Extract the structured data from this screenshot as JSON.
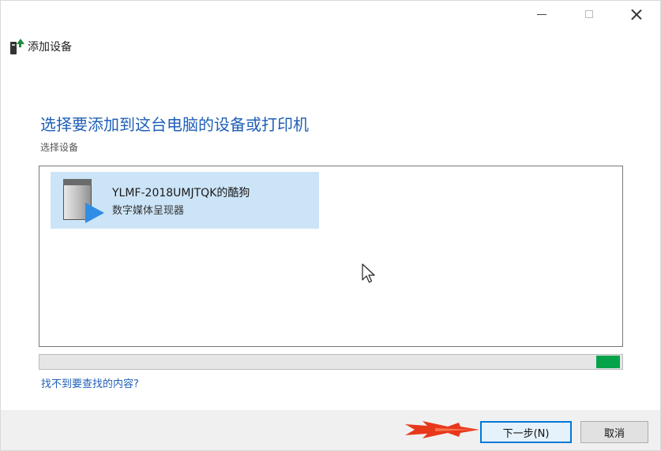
{
  "window": {
    "controls": {
      "minimize": "minimize",
      "maximize": "maximize",
      "close": "close"
    }
  },
  "header": {
    "title": "添加设备",
    "icon": "add-device-icon"
  },
  "main": {
    "heading": "选择要添加到这台电脑的设备或打印机",
    "sub_label": "选择设备",
    "devices": [
      {
        "name": "YLMF-2018UMJTQK的酷狗",
        "type": "数字媒体呈现器",
        "icon": "media-renderer-icon",
        "selected": true
      }
    ]
  },
  "progress": {
    "fill_start": 0.955,
    "fill_end": 0.995,
    "color": "#06a34b"
  },
  "help_link": "找不到要查找的内容?",
  "footer": {
    "next_label": "下一步(N)",
    "cancel_label": "取消"
  },
  "colors": {
    "accent": "#1f5fb8",
    "selection": "#cce4f7",
    "focus_border": "#0078d7",
    "annotation_arrow": "#e8381c"
  }
}
